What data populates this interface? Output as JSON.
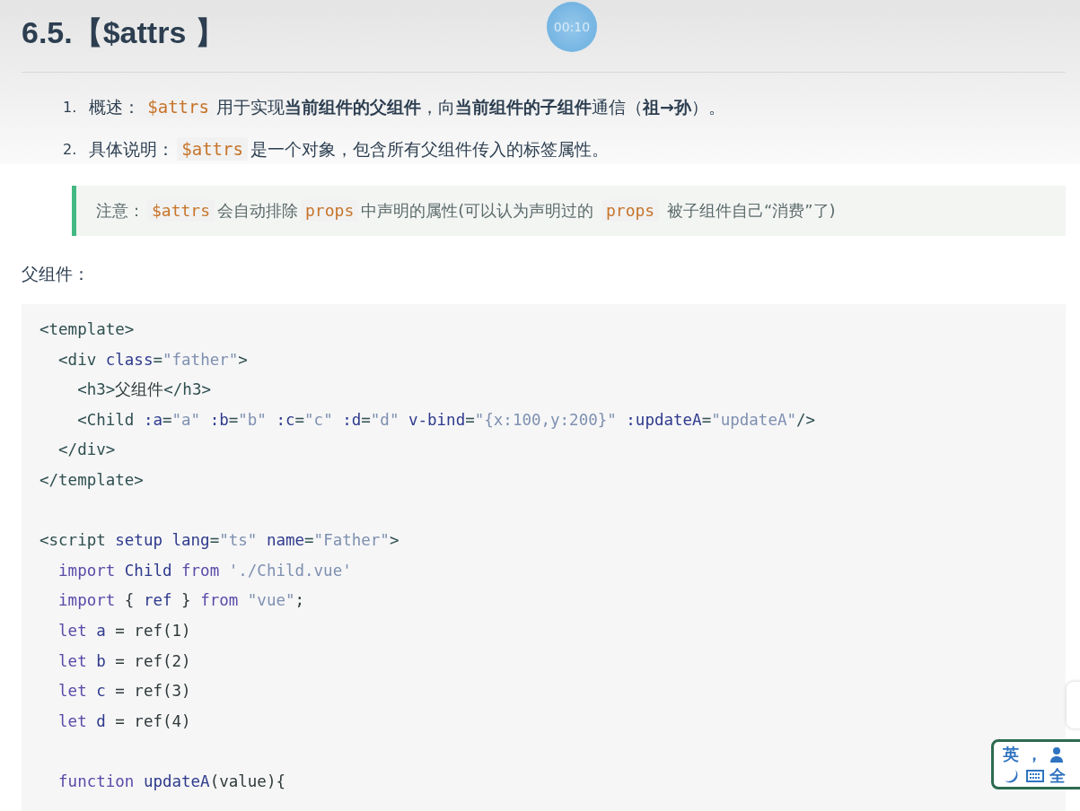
{
  "heading": "6.5.【$attrs 】",
  "timer": "00:10",
  "list": [
    {
      "number": "1.",
      "parts": [
        {
          "kind": "text",
          "text": "概述："
        },
        {
          "kind": "code",
          "text": "$attrs"
        },
        {
          "kind": "text",
          "text": "用于实现"
        },
        {
          "kind": "bold",
          "text": "当前组件的父组件"
        },
        {
          "kind": "text",
          "text": "，向"
        },
        {
          "kind": "bold",
          "text": "当前组件的子组件"
        },
        {
          "kind": "text",
          "text": "通信（"
        },
        {
          "kind": "bold",
          "text": "祖→孙"
        },
        {
          "kind": "text",
          "text": "）。"
        }
      ]
    },
    {
      "number": "2.",
      "parts": [
        {
          "kind": "text",
          "text": "具体说明："
        },
        {
          "kind": "code",
          "text": "$attrs"
        },
        {
          "kind": "text",
          "text": "是一个对象，包含所有父组件传入的标签属性。"
        }
      ]
    }
  ],
  "note": [
    {
      "kind": "text",
      "text": "注意："
    },
    {
      "kind": "code",
      "text": "$attrs"
    },
    {
      "kind": "text",
      "text": "会自动排除"
    },
    {
      "kind": "code",
      "text": "props"
    },
    {
      "kind": "text",
      "text": "中声明的属性(可以认为声明过的 "
    },
    {
      "kind": "code",
      "text": "props"
    },
    {
      "kind": "text",
      "text": " 被子组件自己“消费”了)"
    }
  ],
  "section_label": "父组件：",
  "code_paragraphs": [
    [
      [
        {
          "kind": "tag",
          "text": "<template>"
        }
      ],
      [
        {
          "kind": "tag",
          "text": "  <div "
        },
        {
          "kind": "attr",
          "text": "class"
        },
        {
          "kind": "tag",
          "text": "="
        },
        {
          "kind": "str",
          "text": "\"father\""
        },
        {
          "kind": "tag",
          "text": ">"
        }
      ],
      [
        {
          "kind": "tag",
          "text": "    <h3>"
        },
        {
          "kind": "plain",
          "text": "父组件"
        },
        {
          "kind": "tag",
          "text": "</h3>"
        }
      ],
      [
        {
          "kind": "tag",
          "text": "    <Child "
        },
        {
          "kind": "attr",
          "text": ":a"
        },
        {
          "kind": "tag",
          "text": "="
        },
        {
          "kind": "str",
          "text": "\"a\""
        },
        {
          "kind": "attr",
          "text": " :b"
        },
        {
          "kind": "tag",
          "text": "="
        },
        {
          "kind": "str",
          "text": "\"b\""
        },
        {
          "kind": "attr",
          "text": " :c"
        },
        {
          "kind": "tag",
          "text": "="
        },
        {
          "kind": "str",
          "text": "\"c\""
        },
        {
          "kind": "attr",
          "text": " :d"
        },
        {
          "kind": "tag",
          "text": "="
        },
        {
          "kind": "str",
          "text": "\"d\""
        },
        {
          "kind": "attr",
          "text": " v-bind"
        },
        {
          "kind": "tag",
          "text": "="
        },
        {
          "kind": "str",
          "text": "\"{x:100,y:200}\""
        },
        {
          "kind": "attr",
          "text": " :updateA"
        },
        {
          "kind": "tag",
          "text": "="
        },
        {
          "kind": "str",
          "text": "\"updateA\""
        },
        {
          "kind": "tag",
          "text": "/>"
        }
      ],
      [
        {
          "kind": "tag",
          "text": "  </div>"
        }
      ],
      [
        {
          "kind": "tag",
          "text": "</template>"
        }
      ]
    ],
    [
      [
        {
          "kind": "tag",
          "text": "<script "
        },
        {
          "kind": "attr",
          "text": "setup lang"
        },
        {
          "kind": "tag",
          "text": "="
        },
        {
          "kind": "str",
          "text": "\"ts\""
        },
        {
          "kind": "attr",
          "text": " name"
        },
        {
          "kind": "tag",
          "text": "="
        },
        {
          "kind": "str",
          "text": "\"Father\""
        },
        {
          "kind": "tag",
          "text": ">"
        }
      ],
      [
        {
          "kind": "kw",
          "text": "  import "
        },
        {
          "kind": "attr",
          "text": "Child "
        },
        {
          "kind": "kw",
          "text": "from "
        },
        {
          "kind": "str",
          "text": "'./Child.vue'"
        }
      ],
      [
        {
          "kind": "kw",
          "text": "  import "
        },
        {
          "kind": "plain",
          "text": "{ "
        },
        {
          "kind": "attr",
          "text": "ref"
        },
        {
          "kind": "plain",
          "text": " } "
        },
        {
          "kind": "kw",
          "text": "from "
        },
        {
          "kind": "str",
          "text": "\"vue\""
        },
        {
          "kind": "plain",
          "text": ";"
        }
      ],
      [
        {
          "kind": "kw",
          "text": "  let "
        },
        {
          "kind": "attr",
          "text": "a"
        },
        {
          "kind": "plain",
          "text": " = ref(1)"
        }
      ],
      [
        {
          "kind": "kw",
          "text": "  let "
        },
        {
          "kind": "attr",
          "text": "b"
        },
        {
          "kind": "plain",
          "text": " = ref(2)"
        }
      ],
      [
        {
          "kind": "kw",
          "text": "  let "
        },
        {
          "kind": "attr",
          "text": "c"
        },
        {
          "kind": "plain",
          "text": " = ref(3)"
        }
      ],
      [
        {
          "kind": "kw",
          "text": "  let "
        },
        {
          "kind": "attr",
          "text": "d"
        },
        {
          "kind": "plain",
          "text": " = ref(4)"
        }
      ]
    ],
    [
      [
        {
          "kind": "kw",
          "text": "  function "
        },
        {
          "kind": "attr",
          "text": "updateA"
        },
        {
          "kind": "plain",
          "text": "(value){"
        }
      ]
    ]
  ],
  "ime": {
    "lang": "英",
    "punct": "，",
    "width": "全"
  }
}
